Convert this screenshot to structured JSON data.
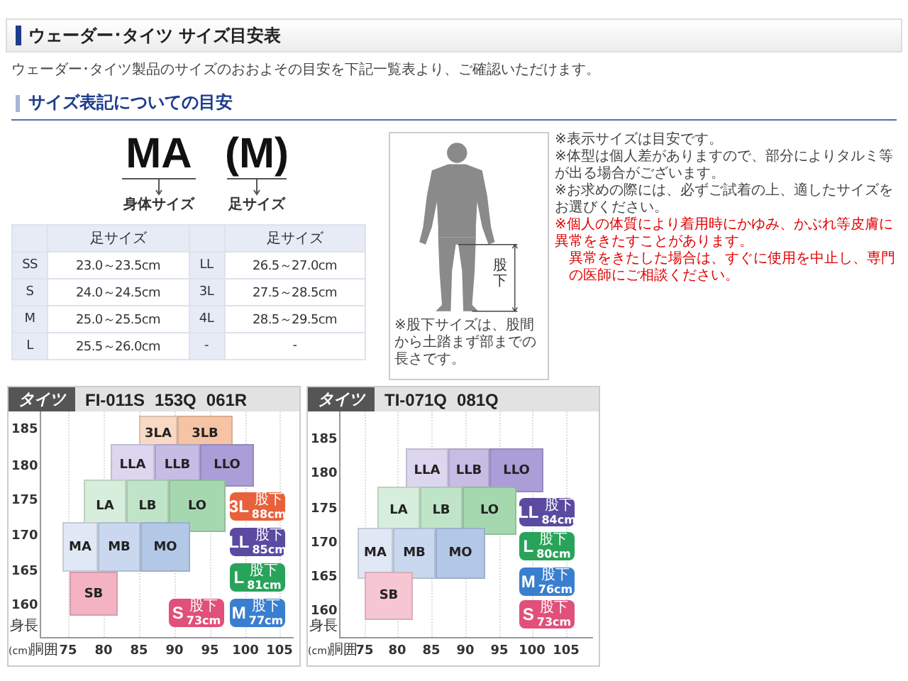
{
  "header": {
    "title": "ウェーダー･タイツ サイズ目安表"
  },
  "intro": "ウェーダー･タイツ製品のサイズのおおよその目安を下記一覧表より、ご確認いただけます。",
  "section": {
    "title": "サイズ表記についての目安"
  },
  "size_code": {
    "body": "MA",
    "foot": "(M)",
    "body_label": "身体サイズ",
    "foot_label": "足サイズ"
  },
  "size_table": {
    "columns": [
      "足サイズ",
      "足サイズ"
    ],
    "rows": [
      {
        "size": "SS",
        "range": "23.0～23.5cm",
        "size_2": "LL",
        "range_2": "26.5～27.0cm"
      },
      {
        "size": "S",
        "range": "24.0～24.5cm",
        "size_2": "3L",
        "range_2": "27.5～28.5cm"
      },
      {
        "size": "M",
        "range": "25.0～25.5cm",
        "size_2": "4L",
        "range_2": "28.5～29.5cm"
      },
      {
        "size": "L",
        "range": "25.5～26.0cm",
        "size_2": "-",
        "range_2": "-"
      }
    ]
  },
  "figure": {
    "inseam_label": "股下",
    "caption": "※股下サイズは、股間から土踏まず部までの長さです。"
  },
  "notes": [
    {
      "kind": "note",
      "text": "※表示サイズは目安です。"
    },
    {
      "kind": "note",
      "text": "※体型は個人差がありますので、部分によりタルミ等が出る場合がございます。"
    },
    {
      "kind": "note",
      "text": "※お求めの際には、必ずご試着の上、適したサイズをお選びください。"
    },
    {
      "kind": "warning",
      "text": "※個人の体質により着用時にかゆみ、かぶれ等皮膚に異常をきたすことがあります。"
    },
    {
      "kind": "warning_continued",
      "text": "異常をきたした場合は、すぐに使用を中止し、専門の医師にご相談ください。"
    }
  ],
  "charts": [
    {
      "tag": "タイツ",
      "models": [
        "FI-011S",
        "153Q",
        "061R"
      ],
      "yticks": [
        "185",
        "180",
        "175",
        "170",
        "165",
        "160"
      ],
      "y_label": "身長",
      "x_unit": "(cm)",
      "x_label": "胴囲",
      "xticks": [
        "75",
        "80",
        "85",
        "90",
        "95",
        "100",
        "105"
      ],
      "boxes": [
        {
          "label": "3LA",
          "color": "#f9d9c4"
        },
        {
          "label": "3LB",
          "color": "#f6c4a4"
        },
        {
          "label": "LLA",
          "color": "#dcd6ef"
        },
        {
          "label": "LLB",
          "color": "#c6bce4"
        },
        {
          "label": "LLO",
          "color": "#ab9dd8"
        },
        {
          "label": "LA",
          "color": "#d6eedb"
        },
        {
          "label": "LB",
          "color": "#c0e4c8"
        },
        {
          "label": "LO",
          "color": "#a6d8b0"
        },
        {
          "label": "MA",
          "color": "#e0e8f5"
        },
        {
          "label": "MB",
          "color": "#cad8ef"
        },
        {
          "label": "MO",
          "color": "#b3c8e7"
        },
        {
          "label": "SB",
          "color": "#f3b3c3"
        }
      ],
      "badges": [
        {
          "size": "3L",
          "label": "股下",
          "length": "88cm",
          "color": "#e8613c"
        },
        {
          "size": "LL",
          "label": "股下",
          "length": "85cm",
          "color": "#5a4aa0"
        },
        {
          "size": "L",
          "label": "股下",
          "length": "81cm",
          "color": "#2aa35a"
        },
        {
          "size": "S",
          "label": "股下",
          "length": "73cm",
          "color": "#e0507a"
        },
        {
          "size": "M",
          "label": "股下",
          "length": "77cm",
          "color": "#3a7fcf"
        }
      ]
    },
    {
      "tag": "タイツ",
      "models": [
        "TI-071Q",
        "081Q"
      ],
      "yticks": [
        "185",
        "180",
        "175",
        "170",
        "165",
        "160"
      ],
      "y_label": "身長",
      "x_unit": "(cm)",
      "x_label": "胴囲",
      "xticks": [
        "75",
        "80",
        "85",
        "90",
        "95",
        "100",
        "105"
      ],
      "boxes": [
        {
          "label": "LLA",
          "color": "#dcd6ef"
        },
        {
          "label": "LLB",
          "color": "#c6bce4"
        },
        {
          "label": "LLO",
          "color": "#ab9dd8"
        },
        {
          "label": "LA",
          "color": "#d6eedb"
        },
        {
          "label": "LB",
          "color": "#c0e4c8"
        },
        {
          "label": "LO",
          "color": "#a6d8b0"
        },
        {
          "label": "MA",
          "color": "#e0e8f5"
        },
        {
          "label": "MB",
          "color": "#cad8ef"
        },
        {
          "label": "MO",
          "color": "#b3c8e7"
        },
        {
          "label": "SB",
          "color": "#f6c6d2"
        }
      ],
      "badges": [
        {
          "size": "LL",
          "label": "股下",
          "length": "84cm",
          "color": "#5a4aa0"
        },
        {
          "size": "L",
          "label": "股下",
          "length": "80cm",
          "color": "#2aa35a"
        },
        {
          "size": "M",
          "label": "股下",
          "length": "76cm",
          "color": "#3a7fcf"
        },
        {
          "size": "S",
          "label": "股下",
          "length": "73cm",
          "color": "#e0507a"
        }
      ]
    }
  ]
}
